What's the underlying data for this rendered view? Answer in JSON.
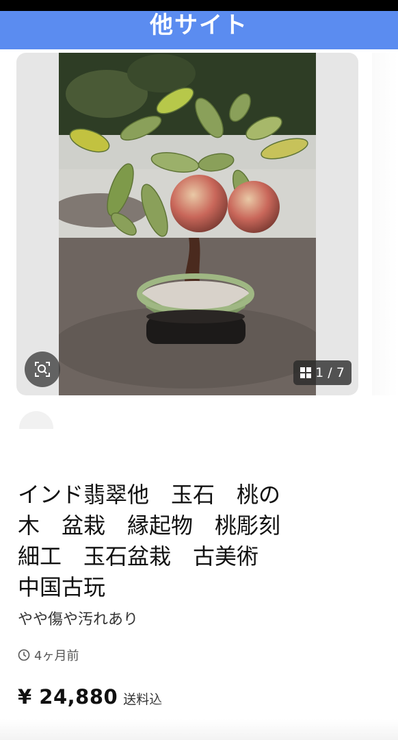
{
  "banner": {
    "label": "他サイト"
  },
  "carousel": {
    "counter": "1 / 7",
    "photo_icon": "jade-peach-bonsai-photo",
    "lens_icon": "image-search-icon",
    "grid_icon": "grid-icon"
  },
  "listing": {
    "title": "インド翡翠他　玉石　桃の\n木　盆栽　縁起物　桃彫刻\n細工　玉石盆栽　古美術\n中国古玩",
    "condition": "やや傷や汚れあり",
    "posted": "4ヶ月前",
    "price": "¥ 24,880",
    "shipping": "送料込"
  },
  "colors": {
    "banner": "#5b8cf0",
    "text": "#111111"
  }
}
